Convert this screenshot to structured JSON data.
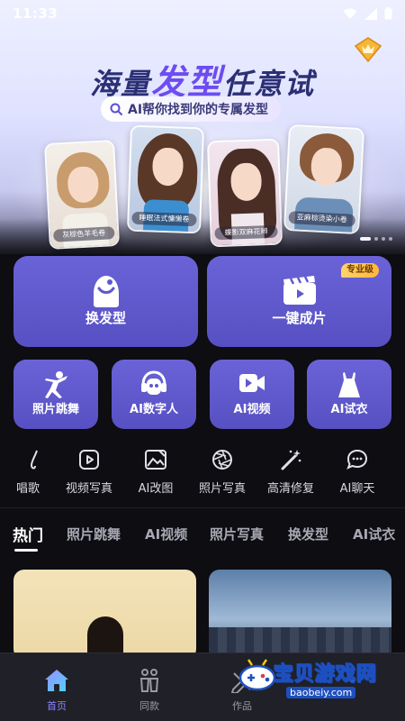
{
  "status_bar": {
    "time": "11:33"
  },
  "hero": {
    "title_part1": "海量",
    "title_accent": "发型",
    "title_part2": "任意试",
    "subtitle": "AI帮你找到你的专属发型",
    "cards": [
      {
        "caption": "灰棕色羊毛卷"
      },
      {
        "caption": "睡眠法式慵懒卷"
      },
      {
        "caption": "蝶影双麻花辫"
      },
      {
        "caption": "亚麻棕烫染小卷"
      }
    ]
  },
  "feature_tiles": [
    {
      "label": "换发型",
      "icon": "hair-cap-icon"
    },
    {
      "label": "一键成片",
      "icon": "clapperboard-icon",
      "badge": "专业级"
    }
  ],
  "small_tiles": [
    {
      "label": "照片跳舞",
      "icon": "dancer-icon"
    },
    {
      "label": "AI数字人",
      "icon": "robot-headphones-icon"
    },
    {
      "label": "AI视频",
      "icon": "video-camera-icon"
    },
    {
      "label": "AI试衣",
      "icon": "dress-icon"
    }
  ],
  "tools": [
    {
      "label": "唱歌",
      "icon": "microphone-icon"
    },
    {
      "label": "视频写真",
      "icon": "video-play-icon"
    },
    {
      "label": "AI改图",
      "icon": "image-edit-icon"
    },
    {
      "label": "照片写真",
      "icon": "aperture-icon"
    },
    {
      "label": "高清修复",
      "icon": "magic-wand-icon"
    },
    {
      "label": "AI聊天",
      "icon": "chat-bubble-icon"
    }
  ],
  "categories": [
    "热门",
    "照片跳舞",
    "AI视频",
    "照片写真",
    "换发型",
    "AI试衣"
  ],
  "bottom_nav": [
    {
      "label": "首页",
      "icon": "home-icon",
      "active": true
    },
    {
      "label": "同款",
      "icon": "same-style-icon",
      "active": false
    },
    {
      "label": "作品",
      "icon": "works-icon",
      "active": false
    }
  ],
  "watermark": {
    "text": "宝贝游戏网",
    "url": "baobeiy.com"
  },
  "colors": {
    "tile": "#5f58cf",
    "accent": "#6d4cf0",
    "background": "#0d0d12",
    "active_nav": "#8d84ff"
  }
}
